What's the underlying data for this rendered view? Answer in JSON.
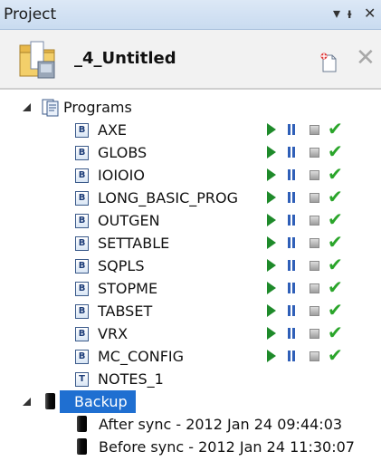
{
  "window": {
    "title": "Project",
    "dropdown_glyph": "▾",
    "pin_glyph": "ᵼ",
    "close_glyph": "✕"
  },
  "project": {
    "name": "_4_Untitled",
    "delete_glyph": "✕"
  },
  "tree": {
    "programs": {
      "label": "Programs",
      "items": [
        {
          "label": "AXE",
          "icon_letter": "B",
          "controls": true
        },
        {
          "label": "GLOBS",
          "icon_letter": "B",
          "controls": true
        },
        {
          "label": "IOIOIO",
          "icon_letter": "B",
          "controls": true
        },
        {
          "label": "LONG_BASIC_PROG",
          "icon_letter": "B",
          "controls": true
        },
        {
          "label": "OUTGEN",
          "icon_letter": "B",
          "controls": true
        },
        {
          "label": "SETTABLE",
          "icon_letter": "B",
          "controls": true
        },
        {
          "label": "SQPLS",
          "icon_letter": "B",
          "controls": true
        },
        {
          "label": "STOPME",
          "icon_letter": "B",
          "controls": true
        },
        {
          "label": "TABSET",
          "icon_letter": "B",
          "controls": true
        },
        {
          "label": "VRX",
          "icon_letter": "B",
          "controls": true
        },
        {
          "label": "MC_CONFIG",
          "icon_letter": "B",
          "controls": true
        },
        {
          "label": "NOTES_1",
          "icon_letter": "T",
          "controls": false
        }
      ]
    },
    "backup": {
      "label": "Backup",
      "items": [
        {
          "label": "After sync - 2012 Jan 24 09:44:03"
        },
        {
          "label": "Before sync - 2012 Jan 24 11:30:07"
        }
      ]
    }
  },
  "colors": {
    "selection": "#1f6fd1",
    "play": "#1e8a2a",
    "pause": "#2f5fb8",
    "check": "#2aa52a"
  },
  "icons": {
    "check_glyph": "✔"
  }
}
